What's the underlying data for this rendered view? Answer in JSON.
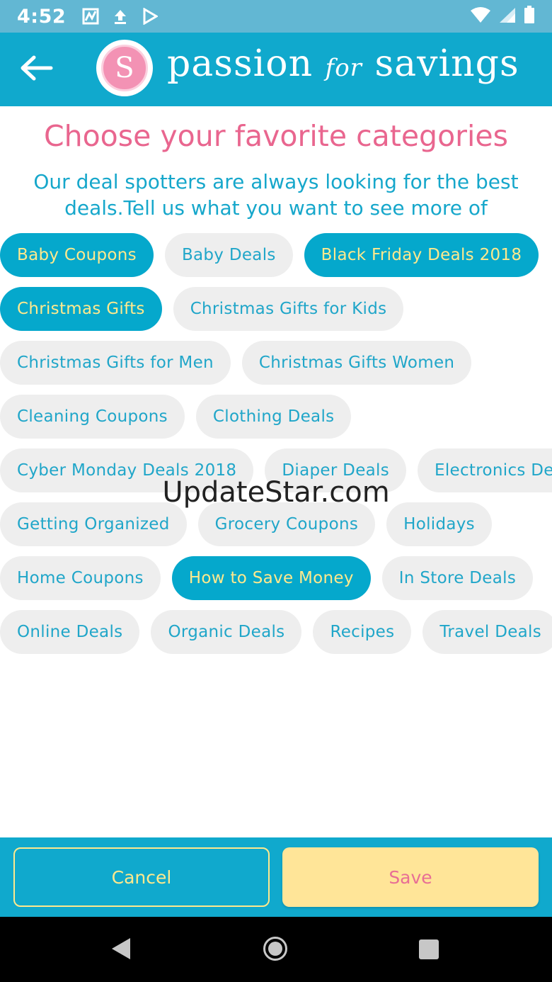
{
  "status_bar": {
    "time": "4:52",
    "left_icons": [
      "image-icon",
      "upload-icon",
      "play-store-icon"
    ],
    "right_icons": [
      "wifi-icon",
      "signal-icon",
      "battery-icon"
    ]
  },
  "app_bar": {
    "back_icon": "arrow-left-icon",
    "logo_letter": "S",
    "logo_word_1": "passion",
    "logo_word_2": "for",
    "logo_word_3": "savings"
  },
  "page": {
    "title": "Choose your favorite categories",
    "subtitle": "Our deal spotters are always looking for the best deals.Tell us what you want to see more of"
  },
  "categories": [
    [
      {
        "label": "Baby Coupons",
        "selected": true
      },
      {
        "label": "Baby Deals",
        "selected": false
      },
      {
        "label": "Black Friday Deals 2018",
        "selected": true
      }
    ],
    [
      {
        "label": "Christmas Gifts",
        "selected": true
      },
      {
        "label": "Christmas Gifts for Kids",
        "selected": false
      }
    ],
    [
      {
        "label": "Christmas Gifts for Men",
        "selected": false
      },
      {
        "label": "Christmas Gifts Women",
        "selected": false
      }
    ],
    [
      {
        "label": "Cleaning Coupons",
        "selected": false
      },
      {
        "label": "Clothing Deals",
        "selected": false
      }
    ],
    [
      {
        "label": "Cyber Monday Deals 2018",
        "selected": false
      },
      {
        "label": "Diaper Deals",
        "selected": false
      },
      {
        "label": "Electronics Deals",
        "selected": false
      }
    ],
    [
      {
        "label": "Getting Organized",
        "selected": false
      },
      {
        "label": "Grocery Coupons",
        "selected": false
      },
      {
        "label": "Holidays",
        "selected": false
      }
    ],
    [
      {
        "label": "Home Coupons",
        "selected": false
      },
      {
        "label": "How to Save Money",
        "selected": true
      },
      {
        "label": "In Store Deals",
        "selected": false
      }
    ],
    [
      {
        "label": "Online Deals",
        "selected": false
      },
      {
        "label": "Organic Deals",
        "selected": false
      },
      {
        "label": "Recipes",
        "selected": false
      },
      {
        "label": "Travel Deals",
        "selected": false
      }
    ]
  ],
  "watermark": "UpdateStar.com",
  "footer": {
    "cancel_label": "Cancel",
    "save_label": "Save"
  },
  "nav_bar": {
    "icons": [
      "nav-back-icon",
      "nav-home-icon",
      "nav-recents-icon"
    ]
  },
  "colors": {
    "accent": "#10a9cd",
    "selected_chip_bg": "#05a8cc",
    "selected_chip_text": "#ffe98d",
    "chip_bg": "#eeeeee",
    "title_pink": "#e9668f",
    "save_bg": "#ffe598"
  }
}
